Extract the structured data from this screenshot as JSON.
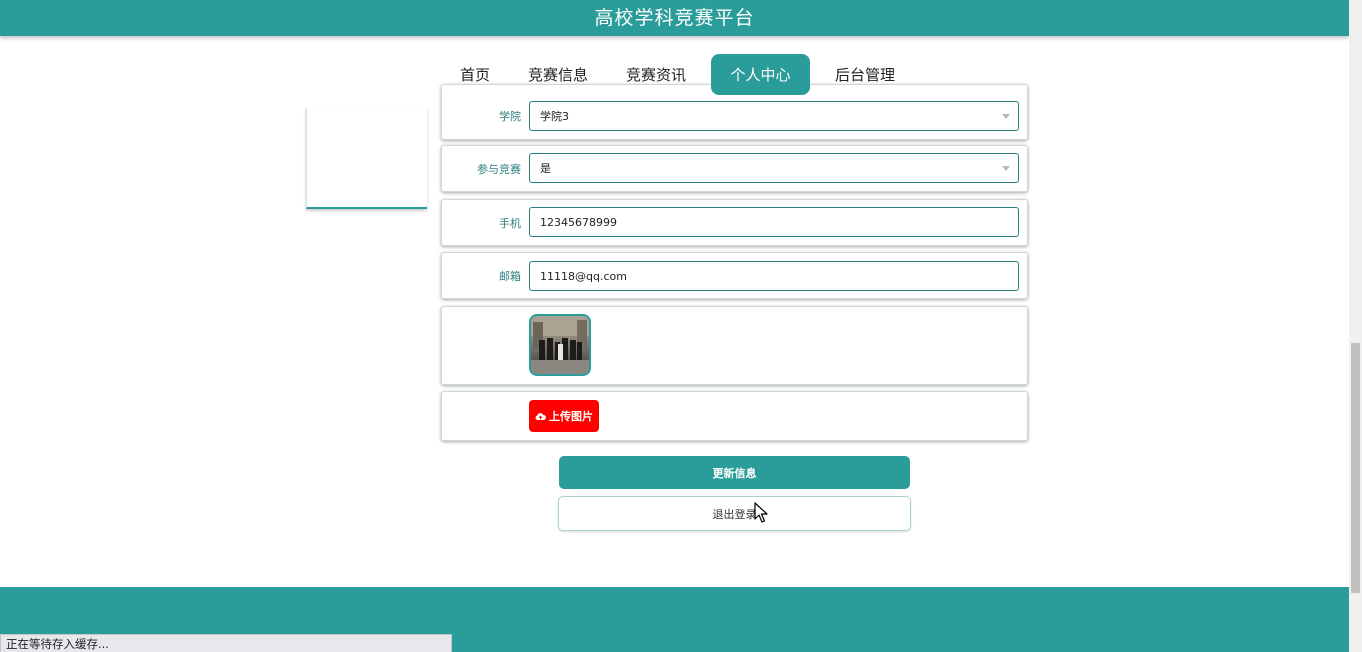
{
  "header": {
    "title": "高校学科竞赛平台"
  },
  "nav": {
    "items": [
      {
        "label": "首页",
        "active": false
      },
      {
        "label": "竞赛信息",
        "active": false
      },
      {
        "label": "竞赛资讯",
        "active": false
      },
      {
        "label": "个人中心",
        "active": true
      },
      {
        "label": "后台管理",
        "active": false
      }
    ]
  },
  "form": {
    "college": {
      "label": "学院",
      "value": "学院3"
    },
    "participate": {
      "label": "参与竞赛",
      "value": "是"
    },
    "phone": {
      "label": "手机",
      "value": "12345678999"
    },
    "email": {
      "label": "邮箱",
      "value": "11118@qq.com"
    },
    "upload_label": "上传图片"
  },
  "buttons": {
    "update": "更新信息",
    "logout": "退出登录"
  },
  "status_bar": "正在等待存入缓存...",
  "colors": {
    "accent": "#2a9d9a",
    "upload": "#ff0000"
  }
}
